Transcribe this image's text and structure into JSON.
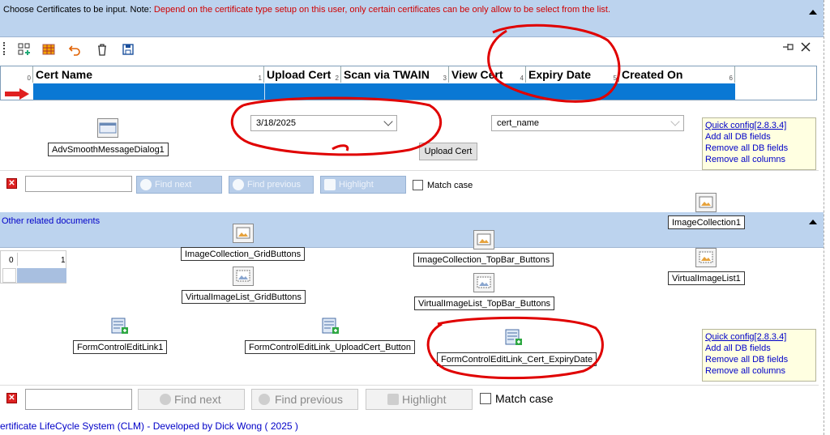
{
  "top_panel": {
    "note_prefix": "Choose Certificates to be input. Note: ",
    "note_warning": "Depend on the certificate type setup on this user, only certain certificates can be only allow to be select from the list."
  },
  "grid": {
    "columns": [
      {
        "index": "0",
        "label": ""
      },
      {
        "index": "1",
        "label": "Cert Name"
      },
      {
        "index": "2",
        "label": "Upload Cert"
      },
      {
        "index": "3",
        "label": "Scan via TWAIN"
      },
      {
        "index": "4",
        "label": "View Cert"
      },
      {
        "index": "5",
        "label": "Expiry Date"
      },
      {
        "index": "6",
        "label": "Created On"
      }
    ]
  },
  "components_top": {
    "msg_dialog": "AdvSmoothMessageDialog1",
    "date_combo": "3/18/2025",
    "upload_button": "Upload Cert",
    "name_combo": "cert_name"
  },
  "quick_config": {
    "title": "Quick config[2.8.3.4]",
    "items": [
      "Add all DB fields",
      "Remove all DB fields",
      "Remove all columns"
    ]
  },
  "find_bar": {
    "find_next": "Find next",
    "find_previous": "Find previous",
    "highlight": "Highlight",
    "match_case": "Match case"
  },
  "bottom_panel": {
    "title": "Other related documents",
    "grid_cols": [
      "0",
      "1"
    ],
    "components": {
      "image_collection_1": "ImageCollection1",
      "image_collection_grid": "ImageCollection_GridButtons",
      "image_collection_topbar": "ImageCollection_TopBar_Buttons",
      "virtual_image_list_1": "VirtualImageList1",
      "virtual_image_list_grid": "VirtualImageList_GridButtons",
      "virtual_image_list_topbar": "VirtualImageList_TopBar_Buttons",
      "edit_link_1": "FormControlEditLink1",
      "edit_link_upload": "FormControlEditLink_UploadCert_Button",
      "edit_link_expiry": "FormControlEditLink_Cert_ExpiryDate"
    }
  },
  "status_bar": "ertificate LifeCycle System (CLM) - Developed by Dick Wong ( 2025 )",
  "colors": {
    "accent": "#0a78d4",
    "panel": "#bcd3ee",
    "link": "#0000c8",
    "annotation": "#e00000"
  }
}
